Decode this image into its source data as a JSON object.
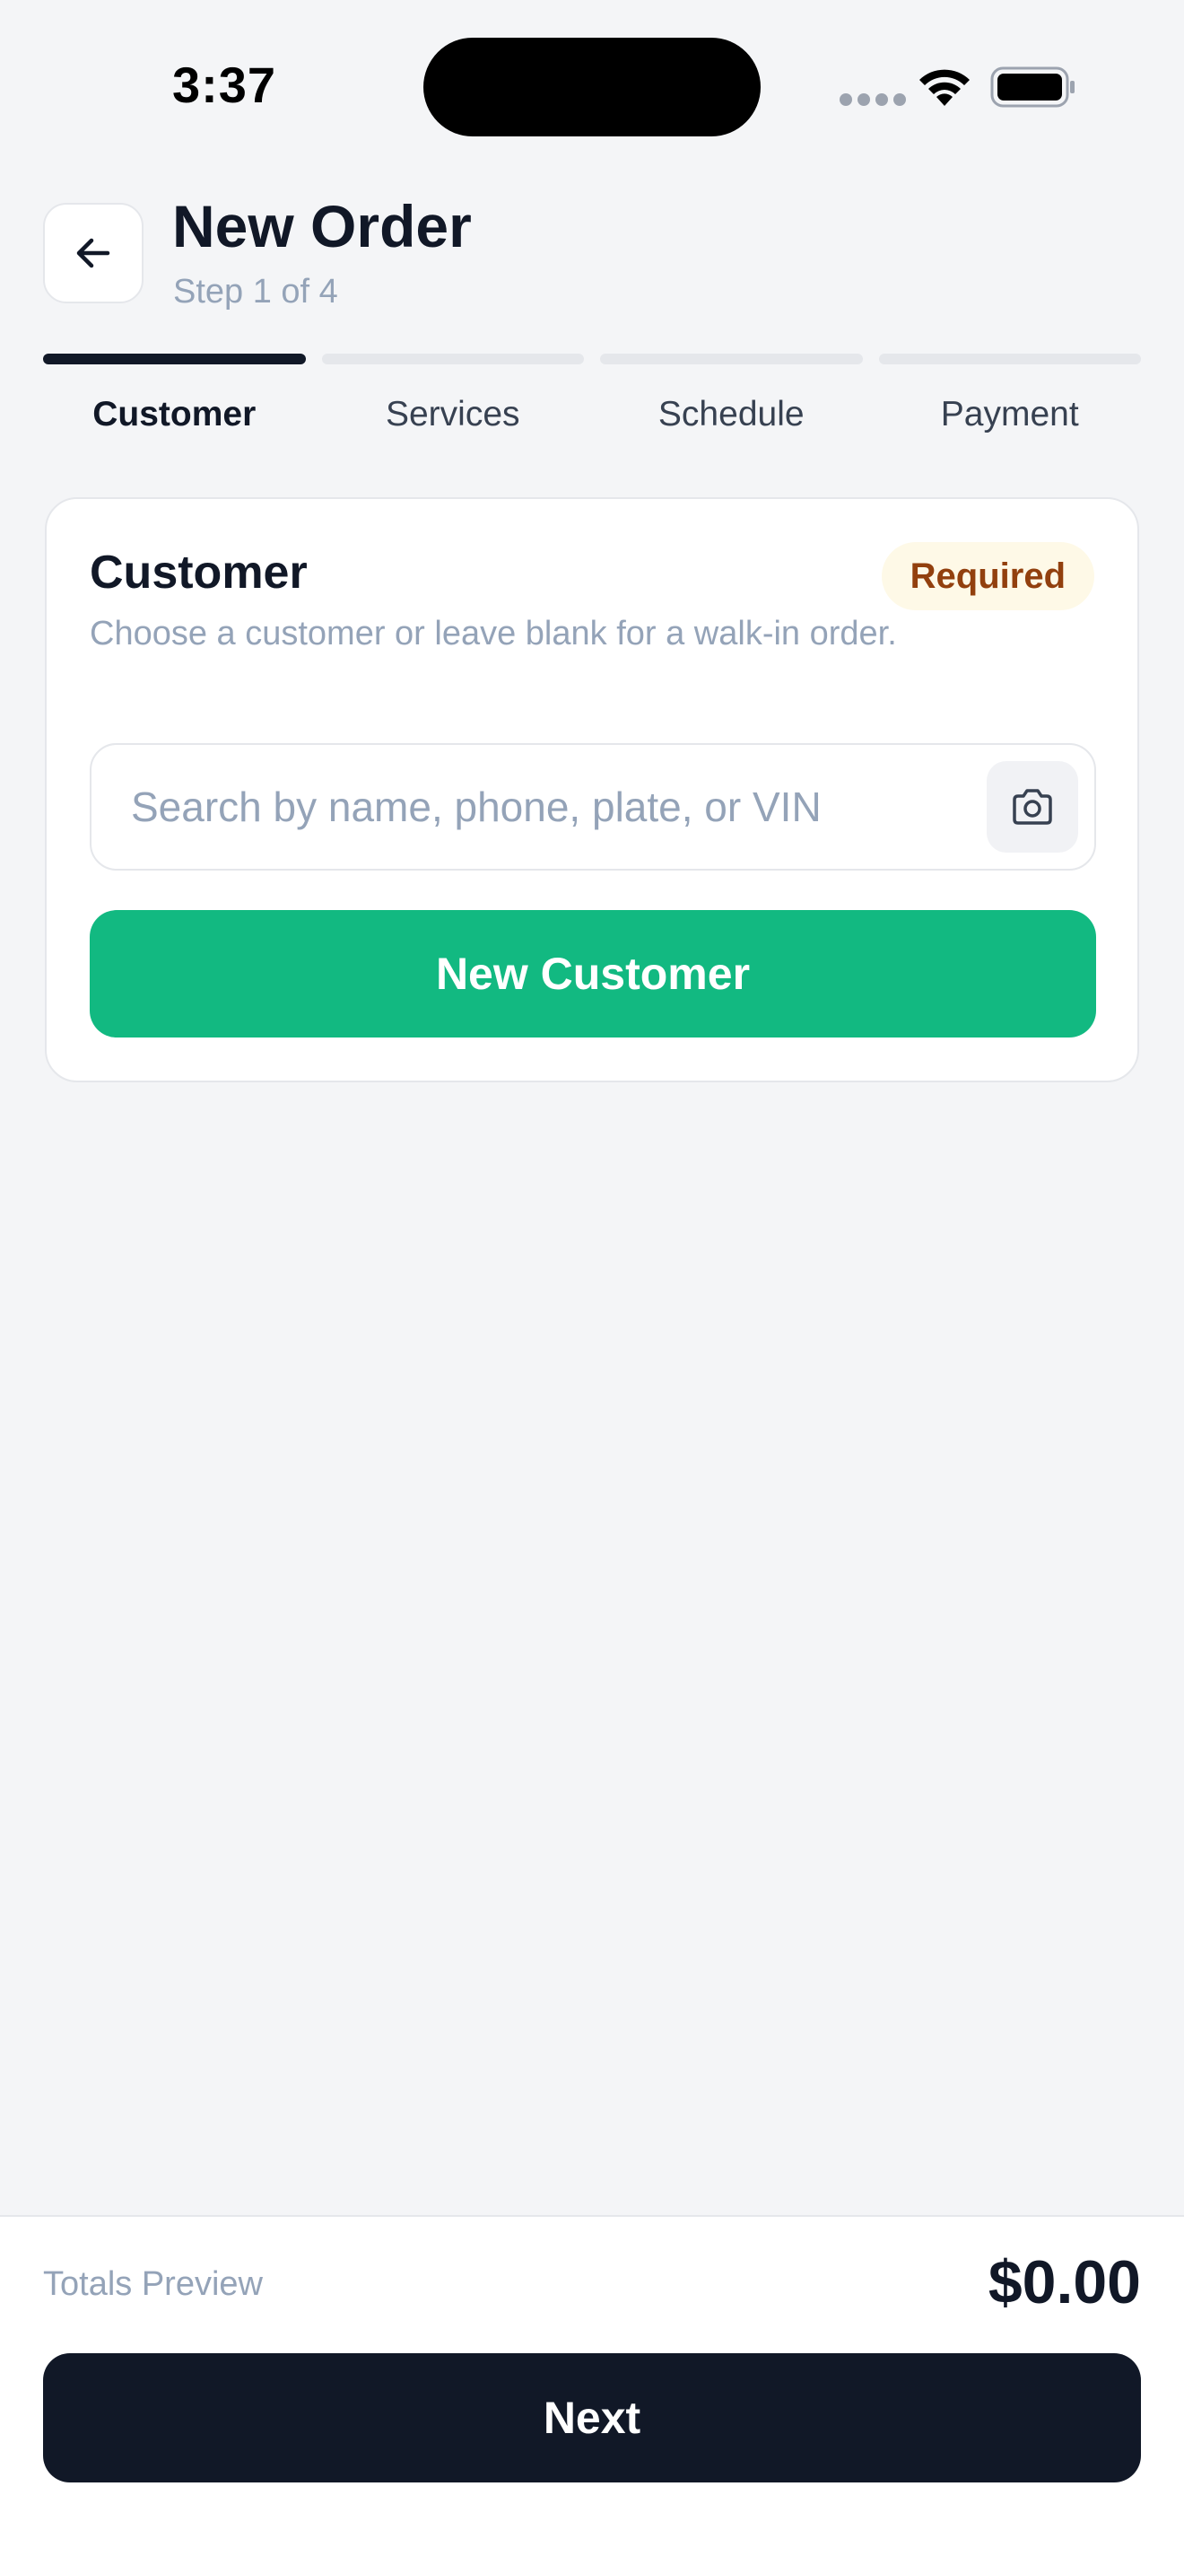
{
  "status_bar": {
    "time": "3:37",
    "icons": [
      "signal-dots-icon",
      "wifi-icon",
      "battery-icon"
    ]
  },
  "header": {
    "back_icon": "arrow-left-icon",
    "title": "New Order",
    "subtitle": "Step 1 of 4"
  },
  "stepper": {
    "current_step": 1,
    "steps": [
      {
        "label": "Customer",
        "active": true
      },
      {
        "label": "Services",
        "active": false
      },
      {
        "label": "Schedule",
        "active": false
      },
      {
        "label": "Payment",
        "active": false
      }
    ]
  },
  "customer_card": {
    "title": "Customer",
    "badge": "Required",
    "description": "Choose a customer or leave blank for a walk-in order.",
    "search": {
      "value": "",
      "placeholder": "Search by name, phone, plate, or VIN",
      "scan_icon": "camera-icon"
    },
    "new_customer_label": "New Customer"
  },
  "footer": {
    "totals_label": "Totals Preview",
    "totals_value": "$0.00",
    "next_label": "Next"
  },
  "colors": {
    "primary_dark": "#111827",
    "accent_green": "#12b981",
    "badge_bg": "#fef9e7",
    "badge_text": "#92400e",
    "background": "#f4f5f7",
    "muted_text": "#94a3b8"
  }
}
